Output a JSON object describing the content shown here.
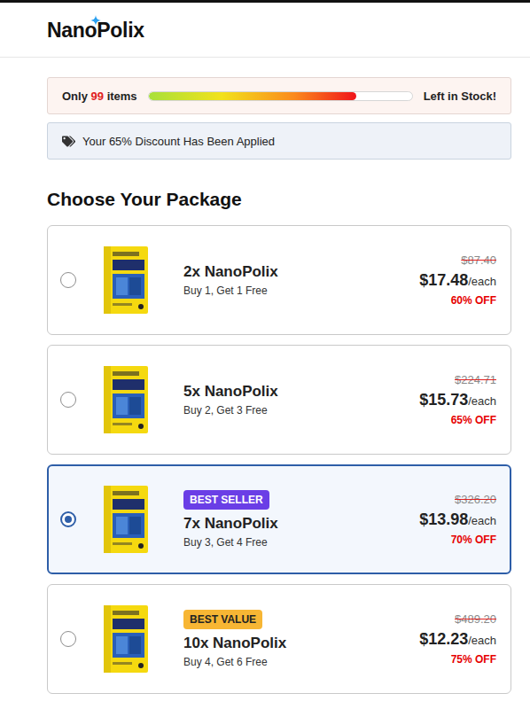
{
  "header": {
    "logo": "NanoPolix"
  },
  "stock": {
    "prefix": "Only",
    "count": "99",
    "suffix": "items",
    "level": 0.79,
    "label": "Left in Stock!"
  },
  "discount": {
    "text": "Your 65% Discount Has Been Applied"
  },
  "heading": "Choose Your Package",
  "packages": [
    {
      "title": "2x NanoPolix",
      "subtitle": "Buy 1, Get 1 Free",
      "original_price": "$87.40",
      "price": "$17.48",
      "unit": "/each",
      "discount": "60% OFF",
      "selected": false
    },
    {
      "title": "5x NanoPolix",
      "subtitle": "Buy 2, Get 3 Free",
      "original_price": "$224.71",
      "price": "$15.73",
      "unit": "/each",
      "discount": "65% OFF",
      "selected": false
    },
    {
      "title": "7x NanoPolix",
      "subtitle": "Buy 3, Get 4 Free",
      "original_price": "$326.20",
      "price": "$13.98",
      "unit": "/each",
      "discount": "70% OFF",
      "selected": true,
      "badge": {
        "label": "BEST SELLER",
        "color": "#6a3ee6"
      }
    },
    {
      "title": "10x NanoPolix",
      "subtitle": "Buy 4, Get 6 Free",
      "original_price": "$489.20",
      "price": "$12.23",
      "unit": "/each",
      "discount": "75% OFF",
      "selected": false,
      "badge": {
        "label": "BEST VALUE",
        "color": "#f7b634"
      }
    }
  ]
}
